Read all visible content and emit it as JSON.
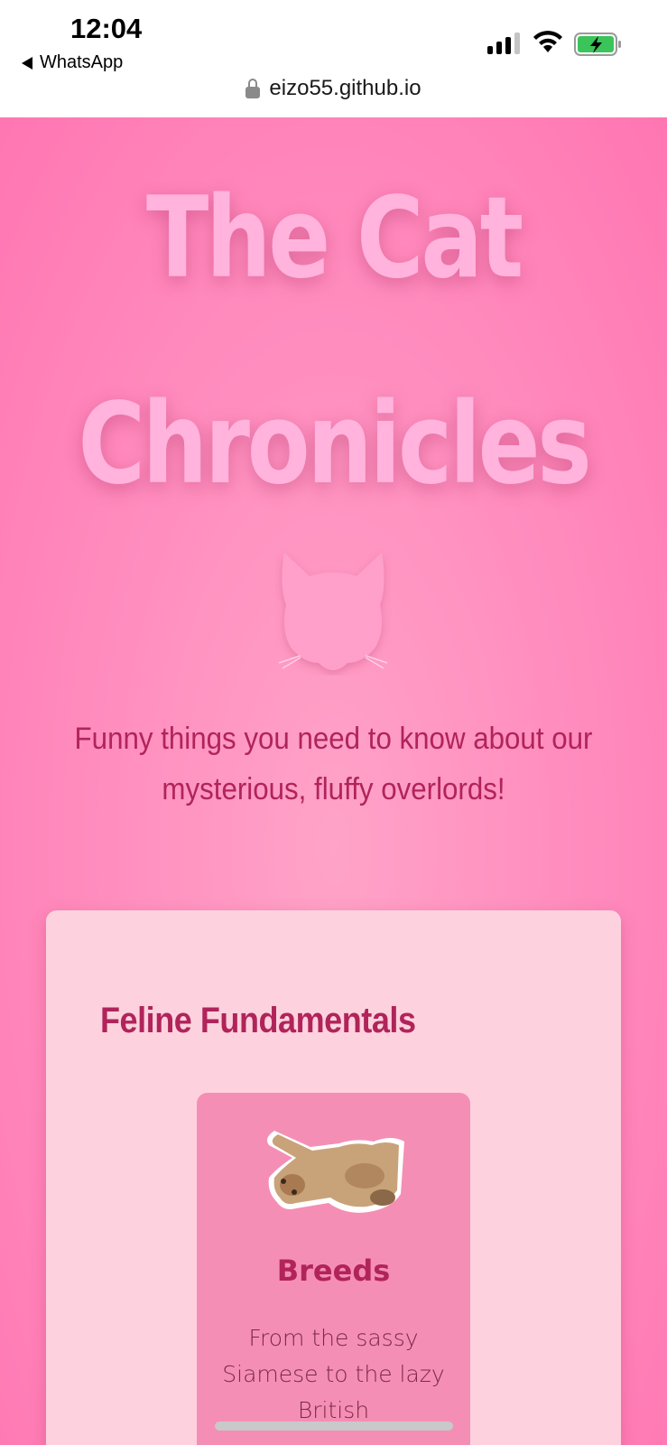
{
  "status_bar": {
    "time": "12:04",
    "back_label": "WhatsApp",
    "url": "eizo55.github.io"
  },
  "hero": {
    "title_line1": "The Cat",
    "title_line2": "Chronicles",
    "tagline": "Funny things you need to know about our mysterious, fluffy overlords!"
  },
  "section": {
    "title": "Feline Fundamentals",
    "tile": {
      "heading": "Breeds",
      "text": "From the sassy Siamese to the lazy British"
    }
  },
  "colors": {
    "page_background": "#ff7fb6",
    "accent": "#b0245a",
    "card": "#fdd2de",
    "tile": "#f58eb5"
  },
  "icons": [
    "lock-icon",
    "cat-logo-icon",
    "wifi-icon",
    "battery-icon",
    "signal-icon",
    "back-arrow-icon"
  ]
}
